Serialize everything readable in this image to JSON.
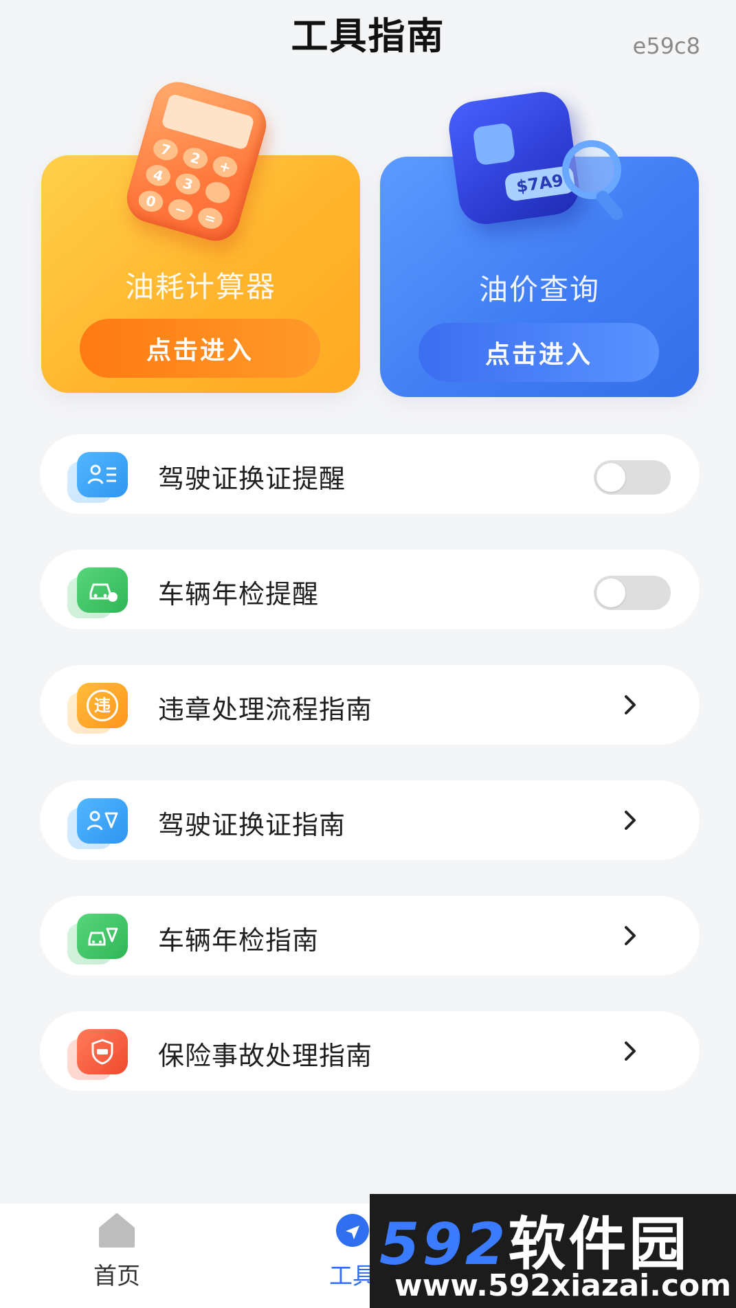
{
  "header": {
    "title": "工具指南",
    "code": "e59c8"
  },
  "cards": [
    {
      "title": "油耗计算器",
      "button": "点击进入",
      "color": "#ffb52d"
    },
    {
      "title": "油价查询",
      "button": "点击进入",
      "color": "#3f7bf2"
    }
  ],
  "illustration": {
    "price_tag": "$7A9",
    "calc_keys": [
      "7",
      "2",
      "+",
      "4",
      "3",
      "",
      "0",
      "−",
      "="
    ]
  },
  "items": [
    {
      "label": "驾驶证换证提醒",
      "icon": "license-person-icon",
      "control": "toggle",
      "on": false
    },
    {
      "label": "车辆年检提醒",
      "icon": "car-inspection-icon",
      "control": "toggle",
      "on": false
    },
    {
      "label": "违章处理流程指南",
      "icon": "violation-badge-icon",
      "glyph": "违",
      "control": "chevron"
    },
    {
      "label": "驾驶证换证指南",
      "icon": "license-send-icon",
      "control": "chevron"
    },
    {
      "label": "车辆年检指南",
      "icon": "car-send-icon",
      "control": "chevron"
    },
    {
      "label": "保险事故处理指南",
      "icon": "insurance-shield-icon",
      "control": "chevron"
    }
  ],
  "bottom_nav": [
    {
      "label": "首页",
      "icon": "home-icon"
    },
    {
      "label": "工具",
      "icon": "tools-icon",
      "active": true
    }
  ],
  "watermark": {
    "brand_digits": "592",
    "brand_text": "软件园",
    "url": "www.592xiazai.com"
  },
  "colors": {
    "accent_blue": "#2f6ff0",
    "accent_orange": "#ff8a1e"
  }
}
